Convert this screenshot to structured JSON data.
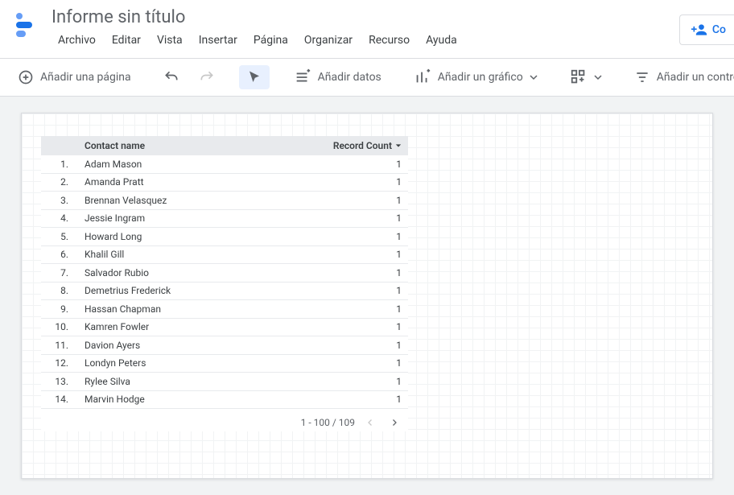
{
  "header": {
    "title": "Informe sin título",
    "menus": [
      "Archivo",
      "Editar",
      "Vista",
      "Insertar",
      "Página",
      "Organizar",
      "Recurso",
      "Ayuda"
    ],
    "share_label": "Co"
  },
  "toolbar": {
    "add_page": "Añadir una página",
    "add_data": "Añadir datos",
    "add_chart": "Añadir un gráfico",
    "add_control": "Añadir un control"
  },
  "table": {
    "header_name": "Contact name",
    "header_count": "Record Count",
    "rows": [
      {
        "num": "1.",
        "name": "Adam Mason",
        "count": "1"
      },
      {
        "num": "2.",
        "name": "Amanda Pratt",
        "count": "1"
      },
      {
        "num": "3.",
        "name": "Brennan Velasquez",
        "count": "1"
      },
      {
        "num": "4.",
        "name": "Jessie Ingram",
        "count": "1"
      },
      {
        "num": "5.",
        "name": "Howard Long",
        "count": "1"
      },
      {
        "num": "6.",
        "name": "Khalil Gill",
        "count": "1"
      },
      {
        "num": "7.",
        "name": "Salvador Rubio",
        "count": "1"
      },
      {
        "num": "8.",
        "name": "Demetrius Frederick",
        "count": "1"
      },
      {
        "num": "9.",
        "name": "Hassan Chapman",
        "count": "1"
      },
      {
        "num": "10.",
        "name": "Kamren Fowler",
        "count": "1"
      },
      {
        "num": "11.",
        "name": "Davion Ayers",
        "count": "1"
      },
      {
        "num": "12.",
        "name": "Londyn Peters",
        "count": "1"
      },
      {
        "num": "13.",
        "name": "Rylee Silva",
        "count": "1"
      },
      {
        "num": "14.",
        "name": "Marvin Hodge",
        "count": "1"
      }
    ],
    "pager": "1 - 100 / 109"
  }
}
